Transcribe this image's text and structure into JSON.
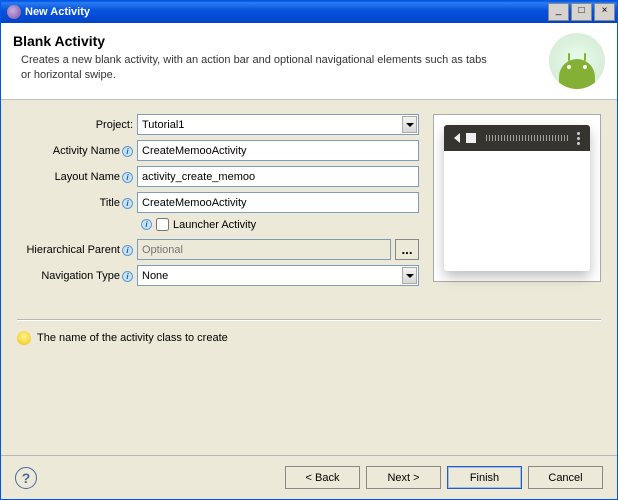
{
  "window": {
    "title": "New Activity"
  },
  "header": {
    "title": "Blank Activity",
    "description": "Creates a new blank activity, with an action bar and optional navigational elements such as tabs or horizontal swipe."
  },
  "form": {
    "project_label": "Project:",
    "project_value": "Tutorial1",
    "activity_name_label": "Activity Name",
    "activity_name_value": "CreateMemooActivity",
    "layout_name_label": "Layout Name",
    "layout_name_value": "activity_create_memoo",
    "title_label": "Title",
    "title_value": "CreateMemooActivity",
    "launcher_label": "Launcher Activity",
    "parent_label": "Hierarchical Parent",
    "parent_placeholder": "Optional",
    "browse_label": "...",
    "nav_label": "Navigation Type",
    "nav_value": "None"
  },
  "hint": {
    "text": "The name of the activity class to create"
  },
  "footer": {
    "back": "< Back",
    "next": "Next >",
    "finish": "Finish",
    "cancel": "Cancel"
  }
}
